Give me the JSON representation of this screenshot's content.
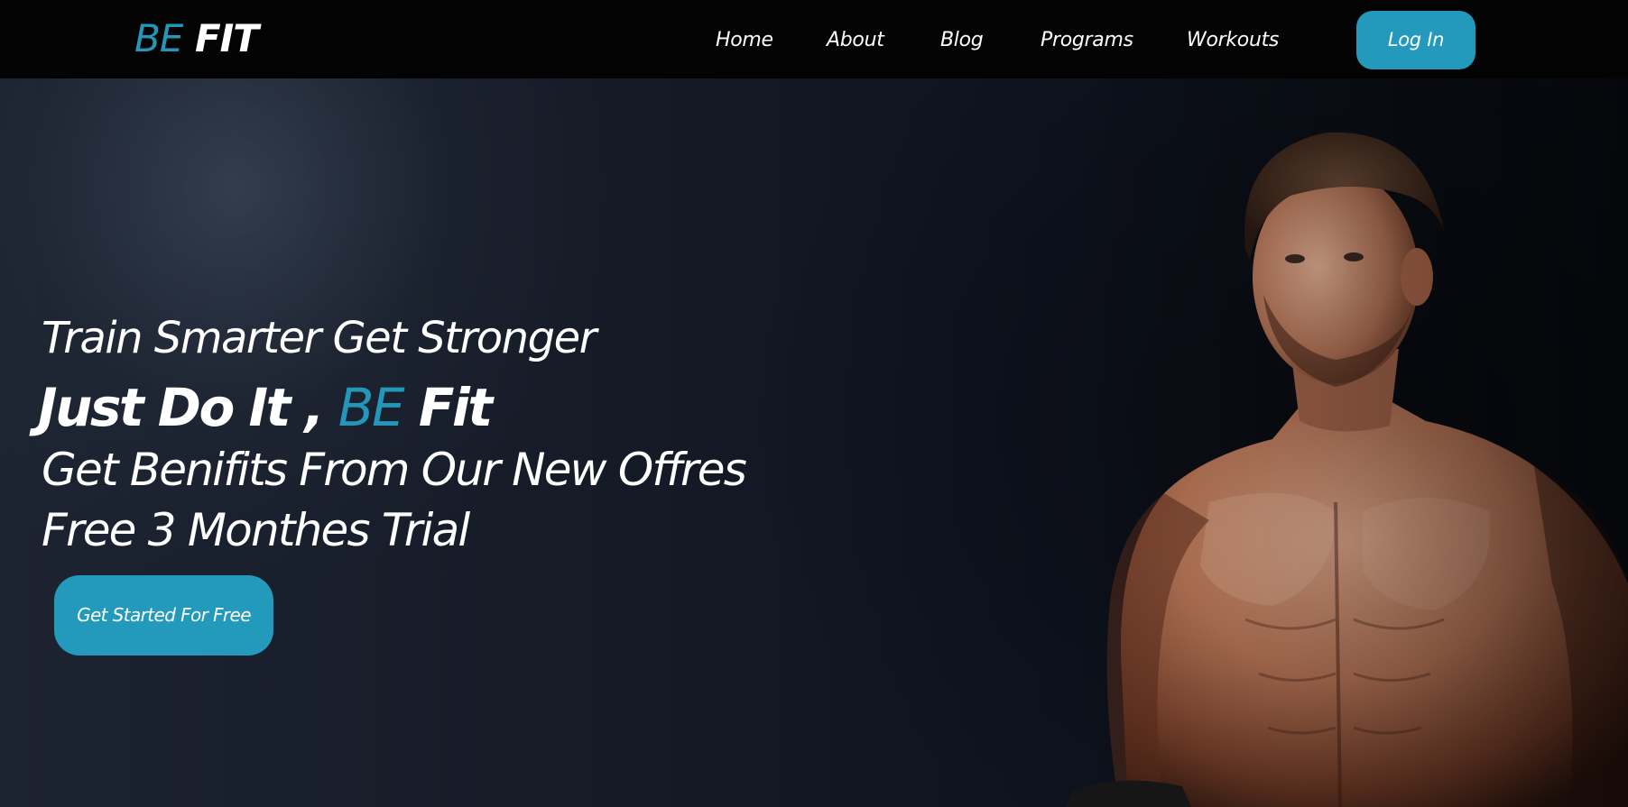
{
  "brand": {
    "logo_accent": "BE",
    "logo_rest": " FIT",
    "accent_color": "#2396ba"
  },
  "nav": {
    "items": [
      {
        "label": "Home"
      },
      {
        "label": "About"
      },
      {
        "label": "Blog"
      },
      {
        "label": "Programs"
      },
      {
        "label": "Workouts"
      }
    ],
    "login_label": "Log In"
  },
  "hero": {
    "tagline": "Train Smarter Get Stronger",
    "headline_start": "Just Do It , ",
    "headline_accent": "BE",
    "headline_end": " Fit",
    "offer_line_1": "Get Benifits From Our New Offres",
    "offer_line_2": "Free 3 Monthes Trial",
    "cta_label": "Get Started For Free",
    "image_subject": "shirtless-athlete-photo"
  }
}
